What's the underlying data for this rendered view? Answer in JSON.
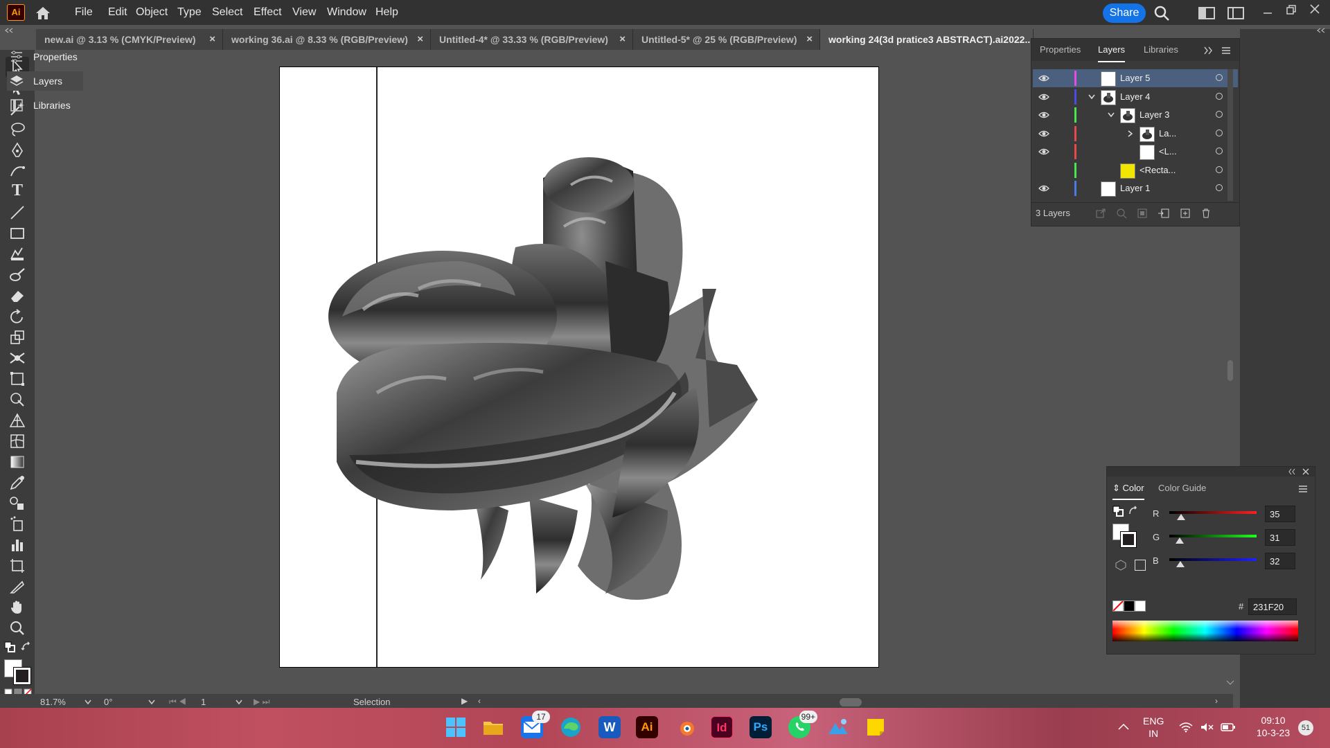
{
  "app": {
    "logo_text": "Ai"
  },
  "menu": [
    "File",
    "Edit",
    "Object",
    "Type",
    "Select",
    "Effect",
    "View",
    "Window",
    "Help"
  ],
  "header": {
    "share_label": "Share"
  },
  "tabs": [
    {
      "label": "new.ai @ 3.13 % (CMYK/Preview)",
      "active": false
    },
    {
      "label": "working 36.ai @ 8.33 % (RGB/Preview)",
      "active": false
    },
    {
      "label": "Untitled-4* @ 33.33 % (RGB/Preview)",
      "active": false
    },
    {
      "label": "Untitled-5* @ 25 % (RGB/Preview)",
      "active": false
    },
    {
      "label": "working 24(3d pratice3  ABSTRACT).ai2022...",
      "active": true
    }
  ],
  "tab_close_glyph": "×",
  "layers_panel": {
    "tabs": [
      "Properties",
      "Layers",
      "Libraries"
    ],
    "active_tab": "Layers",
    "rows": [
      {
        "name": "Layer 5",
        "visible": true,
        "color": "#e64be6",
        "thumb": "white",
        "selected": true,
        "indent": 0,
        "twirl": ""
      },
      {
        "name": "Layer 4",
        "visible": true,
        "color": "#4b4be6",
        "thumb": "art",
        "selected": false,
        "indent": 0,
        "twirl": "down"
      },
      {
        "name": "Layer 3",
        "visible": true,
        "color": "#4be64b",
        "thumb": "art",
        "selected": false,
        "indent": 1,
        "twirl": "down"
      },
      {
        "name": "La...",
        "visible": true,
        "color": "#e64b4b",
        "thumb": "art",
        "selected": false,
        "indent": 2,
        "twirl": "right"
      },
      {
        "name": "<L...",
        "visible": true,
        "color": "#e64b4b",
        "thumb": "white",
        "selected": false,
        "indent": 2,
        "twirl": ""
      },
      {
        "name": "<Recta...",
        "visible": false,
        "color": "#4be64b",
        "thumb": "yellow",
        "selected": false,
        "indent": 1,
        "twirl": ""
      },
      {
        "name": "Layer 1",
        "visible": true,
        "color": "#4b7be6",
        "thumb": "white",
        "selected": false,
        "indent": 0,
        "twirl": ""
      }
    ],
    "footer_count": "3 Layers"
  },
  "dock": [
    {
      "label": "Properties",
      "icon": "properties-icon",
      "active": false
    },
    {
      "label": "Layers",
      "icon": "layers-icon",
      "active": true
    },
    {
      "label": "Libraries",
      "icon": "libraries-icon",
      "active": false
    }
  ],
  "color_panel": {
    "tabs": [
      "Color",
      "Color Guide"
    ],
    "channels": [
      {
        "label": "R",
        "value": "35",
        "fraction": 0.137,
        "gradient": "linear-gradient(90deg,#000,#ff2020)"
      },
      {
        "label": "G",
        "value": "31",
        "fraction": 0.122,
        "gradient": "linear-gradient(90deg,#000,#20ff20)"
      },
      {
        "label": "B",
        "value": "32",
        "fraction": 0.125,
        "gradient": "linear-gradient(90deg,#000,#2020ff)"
      }
    ],
    "hash_label": "#",
    "hex": "231F20"
  },
  "status": {
    "zoom": "81.7%",
    "rotation": "0°",
    "artboard": "1",
    "tool": "Selection"
  },
  "taskbar": {
    "mail_badge": "17",
    "whatsapp_badge": "99+",
    "lang_line1": "ENG",
    "lang_line2": "IN",
    "time": "09:10",
    "date": "10-3-23",
    "notif_count": "51",
    "app_labels": {
      "illustrator": "Ai",
      "indesign": "Id",
      "photoshop": "Ps"
    }
  }
}
